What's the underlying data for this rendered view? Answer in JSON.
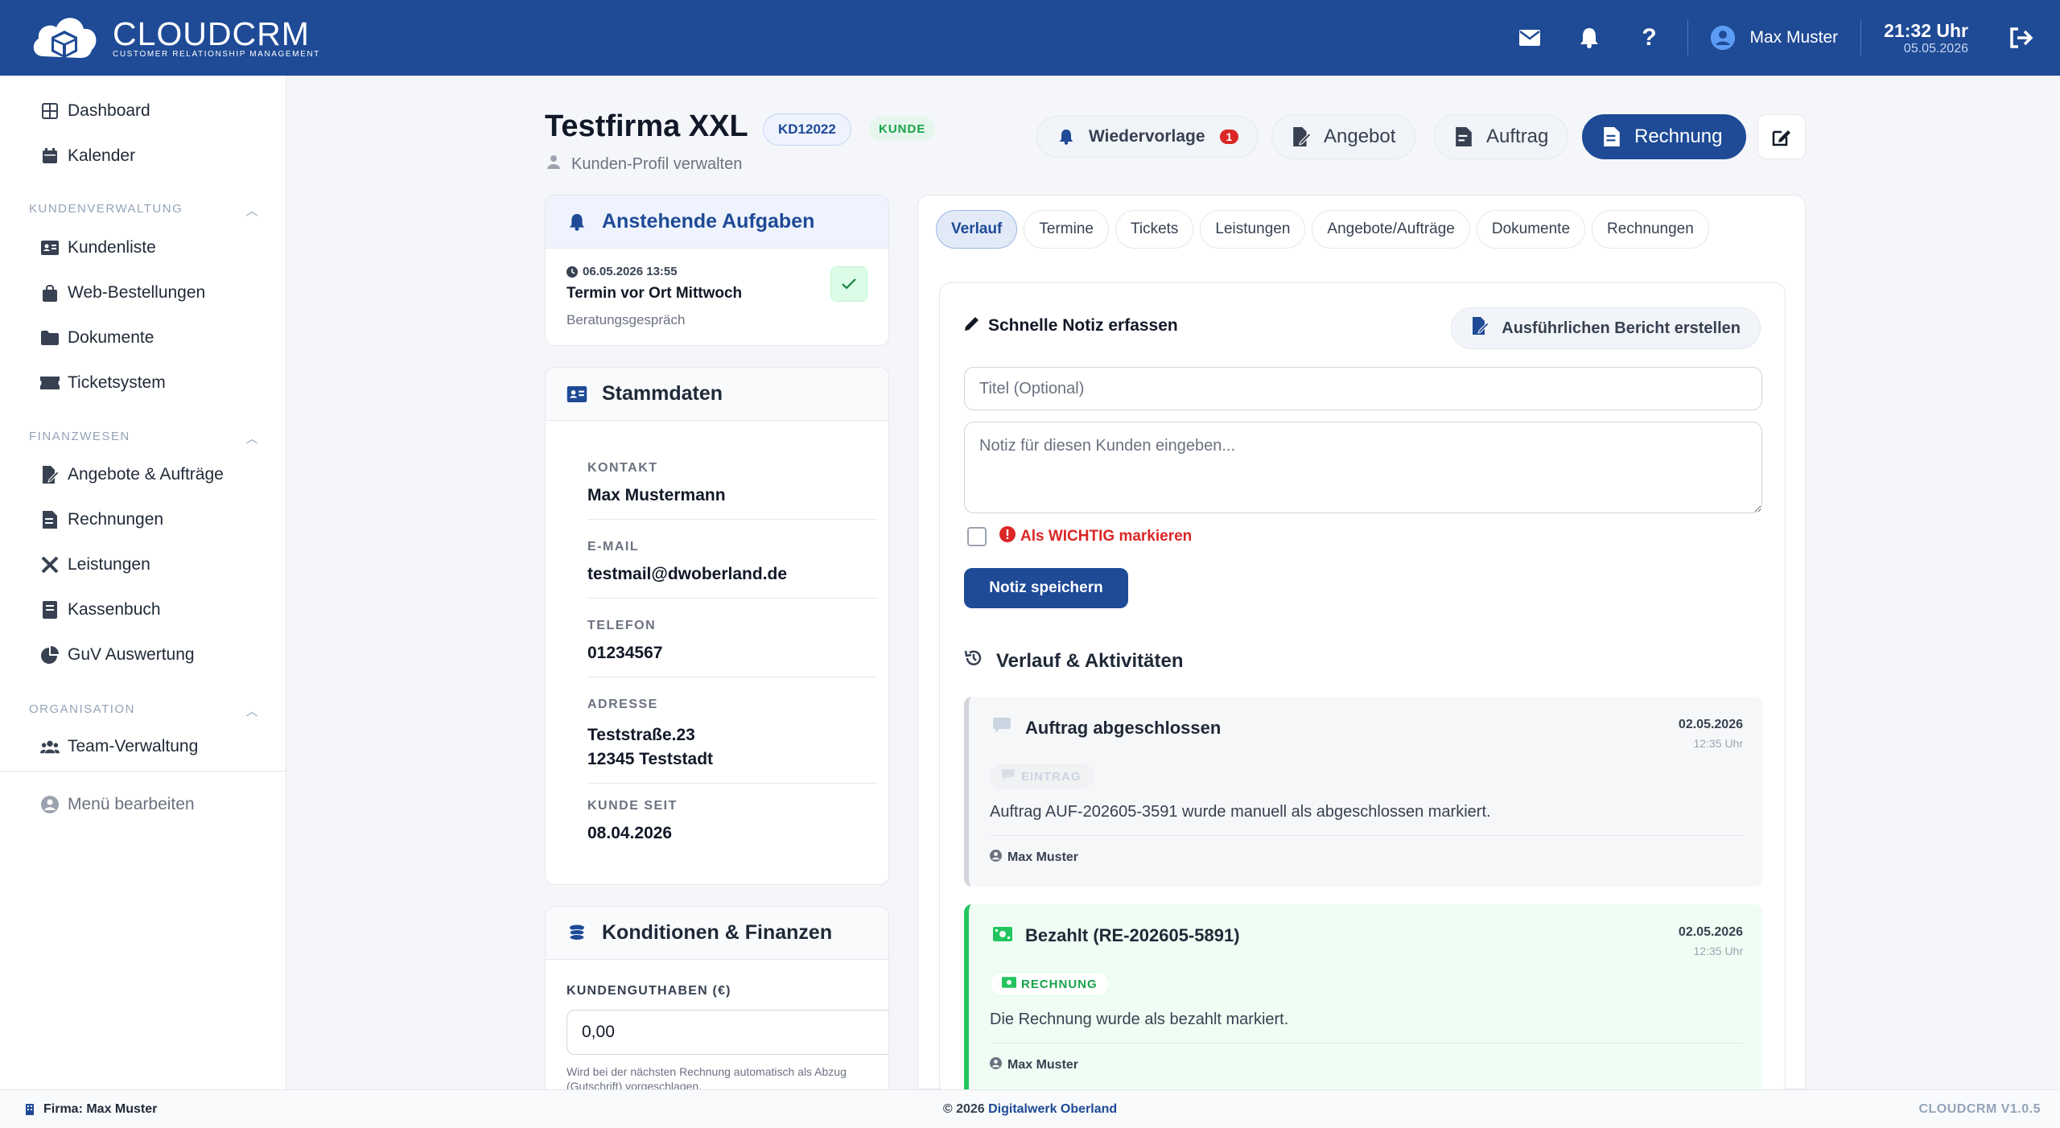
{
  "app": {
    "logo_name": "CLOUDCRM",
    "logo_sub": "CUSTOMER RELATIONSHIP MANAGEMENT"
  },
  "topbar": {
    "user_name": "Max Muster",
    "time": "21:32 Uhr",
    "date": "05.05.2026",
    "icons": [
      "mail-icon",
      "bell-icon",
      "help-icon",
      "user-circle-icon",
      "logout-icon"
    ]
  },
  "sidebar": {
    "items_top": [
      {
        "label": "Dashboard",
        "icon": "grid-icon"
      },
      {
        "label": "Kalender",
        "icon": "calendar-icon"
      }
    ],
    "sections": [
      {
        "title": "KUNDENVERWALTUNG",
        "items": [
          {
            "label": "Kundenliste",
            "icon": "id-card-icon"
          },
          {
            "label": "Web-Bestellungen",
            "icon": "shopping-bag-icon"
          },
          {
            "label": "Dokumente",
            "icon": "folder-icon"
          },
          {
            "label": "Ticketsystem",
            "icon": "ticket-icon"
          }
        ]
      },
      {
        "title": "FINANZWESEN",
        "items": [
          {
            "label": "Angebote & Aufträge",
            "icon": "file-signature-icon"
          },
          {
            "label": "Rechnungen",
            "icon": "invoice-icon"
          },
          {
            "label": "Leistungen",
            "icon": "tools-icon"
          },
          {
            "label": "Kassenbuch",
            "icon": "book-icon"
          },
          {
            "label": "GuV Auswertung",
            "icon": "pie-chart-icon"
          }
        ]
      },
      {
        "title": "ORGANISATION",
        "items": [
          {
            "label": "Team-Verwaltung",
            "icon": "users-icon"
          }
        ]
      }
    ],
    "edit_menu": "Menü bearbeiten"
  },
  "header": {
    "title": "Testfirma XXL",
    "customer_id": "KD12022",
    "status": "KUNDE",
    "subtitle": "Kunden-Profil verwalten",
    "buttons": {
      "wiedervorlage": "Wiedervorlage",
      "wiedervorlage_count": "1",
      "angebot": "Angebot",
      "auftrag": "Auftrag",
      "rechnung": "Rechnung"
    }
  },
  "tasks": {
    "title": "Anstehende Aufgaben",
    "items": [
      {
        "datetime": "06.05.2026 13:55",
        "title": "Termin vor Ort Mittwoch",
        "subtitle": "Beratungsgespräch"
      }
    ]
  },
  "stammdaten": {
    "title": "Stammdaten",
    "fields": [
      {
        "label": "KONTAKT",
        "value": "Max Mustermann"
      },
      {
        "label": "E-MAIL",
        "value": "testmail@dwoberland.de"
      },
      {
        "label": "TELEFON",
        "value": "01234567"
      },
      {
        "label": "ADRESSE",
        "value": "Teststraße.23",
        "value2": "12345 Teststadt"
      },
      {
        "label": "KUNDE SEIT",
        "value": "08.04.2026"
      }
    ]
  },
  "finanzen": {
    "title": "Konditionen & Finanzen",
    "guthaben_label": "KUNDENGUTHABEN (€)",
    "guthaben_value": "0,00",
    "hint": "Wird bei der nächsten Rechnung automatisch als Abzug (Gutschrift) vorgeschlagen."
  },
  "tabs": [
    "Verlauf",
    "Termine",
    "Tickets",
    "Leistungen",
    "Angebote/Aufträge",
    "Dokumente",
    "Rechnungen"
  ],
  "note": {
    "title": "Schnelle Notiz erfassen",
    "report_button": "Ausführlichen Bericht erstellen",
    "title_placeholder": "Titel (Optional)",
    "note_placeholder": "Notiz für diesen Kunden eingeben...",
    "important_label": "Als WICHTIG markieren",
    "save_button": "Notiz speichern"
  },
  "history": {
    "title": "Verlauf & Aktivitäten",
    "entries": [
      {
        "title": "Auftrag abgeschlossen",
        "date": "02.05.2026",
        "time": "12:35 Uhr",
        "badge": "EINTRAG",
        "text": "Auftrag AUF-202605-3591 wurde manuell als abgeschlossen markiert.",
        "user": "Max Muster"
      },
      {
        "title": "Bezahlt (RE-202605-5891)",
        "date": "02.05.2026",
        "time": "12:35 Uhr",
        "badge": "RECHNUNG",
        "text": "Die Rechnung wurde als bezahlt markiert.",
        "user": "Max Muster"
      }
    ]
  },
  "footer": {
    "firma": "Firma: Max Muster",
    "copyright": "© 2026 ",
    "company_link": "Digitalwerk Oberland",
    "version": "CLOUDCRM V1.0.5"
  },
  "colors": {
    "primary": "#1e4a96",
    "danger": "#dc2626",
    "success": "#16a34a"
  }
}
